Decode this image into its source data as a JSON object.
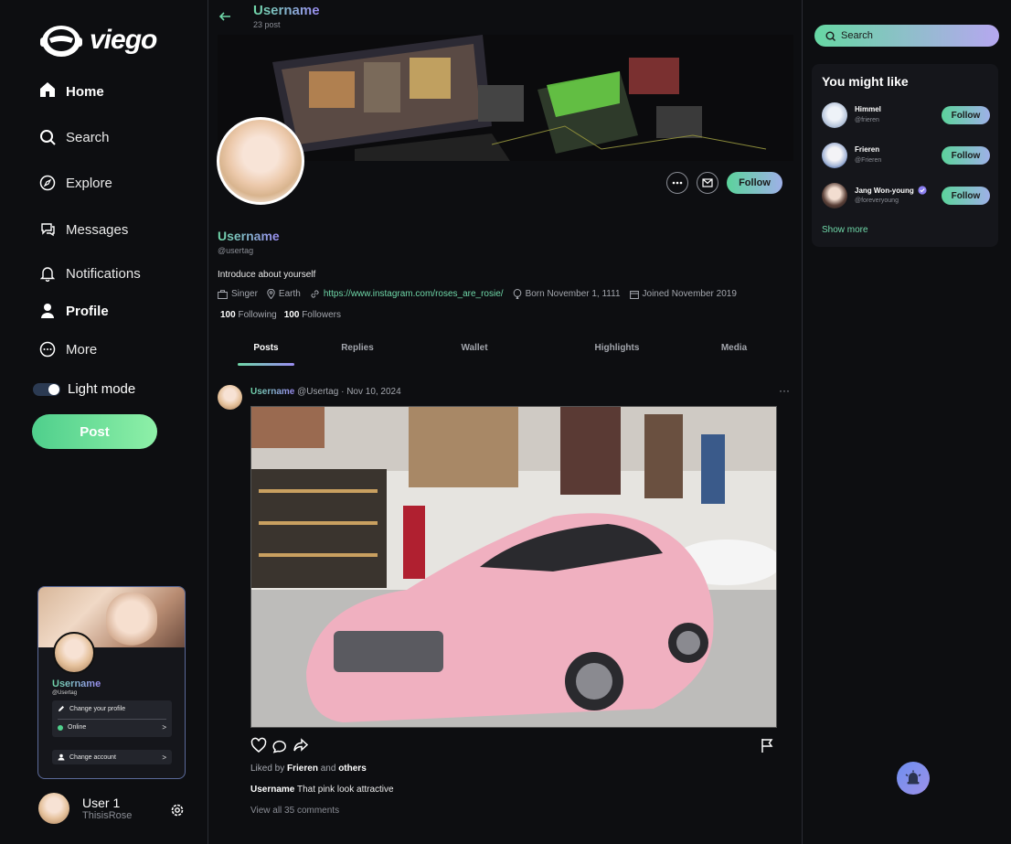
{
  "app": {
    "logo_text": "viego",
    "accent_gradient": [
      "#6fd7a8",
      "#9a8cf2"
    ]
  },
  "nav": {
    "items": [
      {
        "label": "Home",
        "icon": "home-icon"
      },
      {
        "label": "Search",
        "icon": "search-icon"
      },
      {
        "label": "Explore",
        "icon": "compass-icon"
      },
      {
        "label": "Messages",
        "icon": "chat-icon"
      },
      {
        "label": "Notifications",
        "icon": "bell-icon"
      },
      {
        "label": "Profile",
        "icon": "user-icon"
      },
      {
        "label": "More",
        "icon": "more-circle-icon"
      }
    ],
    "light_mode_label": "Light mode",
    "post_label": "Post"
  },
  "card": {
    "name": "Username",
    "tag": "@Usertag",
    "change_profile": "Change your profile",
    "online": "Online",
    "change_account": "Change account",
    "arrow": ">"
  },
  "current_user": {
    "name": "User 1",
    "tag": "ThisisRose"
  },
  "header": {
    "title": "Username",
    "post_count": "23 post"
  },
  "profile": {
    "name": "Username",
    "tag": "@usertag",
    "bio": "Introduce about yourself",
    "follow_label": "Follow",
    "occupation": "Singer",
    "location": "Earth",
    "link": "https://www.instagram.com/roses_are_rosie/",
    "born": "Born November 1, 1111",
    "joined": "Joined November 2019",
    "following_count": "100",
    "following_label": "Following",
    "followers_count": "100",
    "followers_label": "Followers"
  },
  "tabs": [
    "Posts",
    "Replies",
    "Wallet",
    "Highlights",
    "Media"
  ],
  "post": {
    "author": "Username",
    "meta": "@Usertag · Nov 10, 2024",
    "more": "···",
    "liked_prefix": "Liked by",
    "liked_user": "Frieren",
    "liked_and": "and",
    "liked_others": "others",
    "caption_user": "Username",
    "caption_text": "That pink look attractive",
    "comments": "View all 35 comments"
  },
  "right": {
    "search_label": "Search",
    "suggest_title": "You might like",
    "follow_label": "Follow",
    "suggestions": [
      {
        "name": "Himmel",
        "tag": "@frieren"
      },
      {
        "name": "Frieren",
        "tag": "@Frieren"
      },
      {
        "name": "Jang Won-young",
        "tag": "@foreveryoung",
        "verified": true
      }
    ],
    "show_more": "Show more"
  }
}
